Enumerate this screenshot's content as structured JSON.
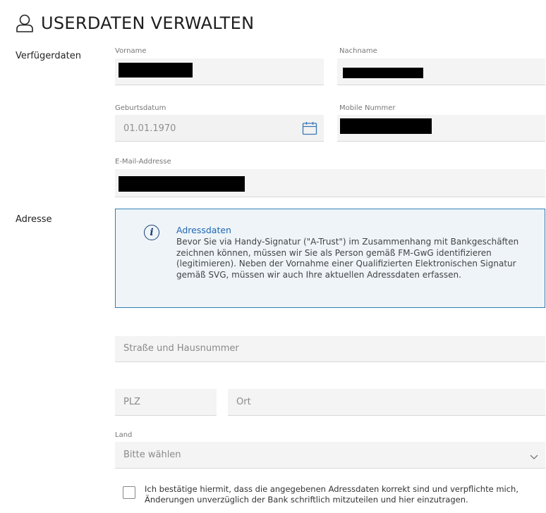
{
  "page": {
    "title": "USERDATEN VERWALTEN"
  },
  "sections": {
    "verfuegerdaten": "Verfügerdaten",
    "adresse": "Adresse"
  },
  "fields": {
    "vorname": {
      "label": "Vorname",
      "value": ""
    },
    "nachname": {
      "label": "Nachname",
      "value": ""
    },
    "geburtsdatum": {
      "label": "Geburtsdatum",
      "value": "01.01.1970"
    },
    "mobile": {
      "label": "Mobile Nummer",
      "value": ""
    },
    "email": {
      "label": "E-Mail-Addresse",
      "value": ""
    },
    "strasse": {
      "placeholder": "Straße und Hausnummer"
    },
    "plz": {
      "placeholder": "PLZ"
    },
    "ort": {
      "placeholder": "Ort"
    },
    "land": {
      "label": "Land",
      "value": "Bitte wählen"
    }
  },
  "info": {
    "title": "Adressdaten",
    "text": "Bevor Sie via Handy-Signatur (\"A-Trust\") im Zusammenhang mit Bankgeschäften zeichnen können, müssen wir Sie als Person gemäß FM-GwG identifizieren (legitimieren). Neben der Vornahme einer Qualifizierten Elektronischen Signatur gemäß SVG, müssen wir auch Ihre aktuellen Adressdaten erfassen."
  },
  "confirm": {
    "text": "Ich bestätige hiermit, dass die angegebenen Adressdaten korrekt sind und verpflichte mich, Änderungen unverzüglich der Bank schriftlich mitzuteilen und hier einzutragen."
  },
  "icons": {
    "title": "user-icon",
    "calendar": "calendar-icon",
    "info": "info-icon",
    "land": "chevron-down-icon"
  },
  "colors": {
    "accent": "#1f66b0",
    "info_border": "#2f7fb2",
    "info_bg": "#eef4f8",
    "field_bg": "#f4f4f4"
  }
}
